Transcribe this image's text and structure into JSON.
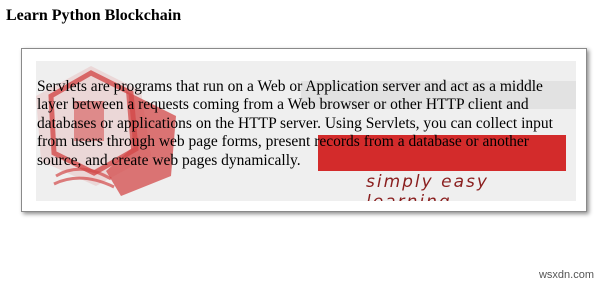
{
  "page": {
    "title": "Learn Python Blockchain"
  },
  "panel": {
    "description": "Servlets are programs that run on a Web or Application server and act as a middle layer between a requests coming from a Web browser or other HTTP client and databases or applications on the HTTP server. Using Servlets, you can collect input from users through web page forms, present records from a database or another source, and create web pages dynamically.",
    "background_image": {
      "tagline": "simply easy learning",
      "icon": "coffee-logo-icon"
    }
  },
  "watermark": "wsxdn.com",
  "colors": {
    "banner_red": "#d32b2b",
    "tagline_red": "#8a1f1f",
    "logo_red": "#d34a4a"
  }
}
